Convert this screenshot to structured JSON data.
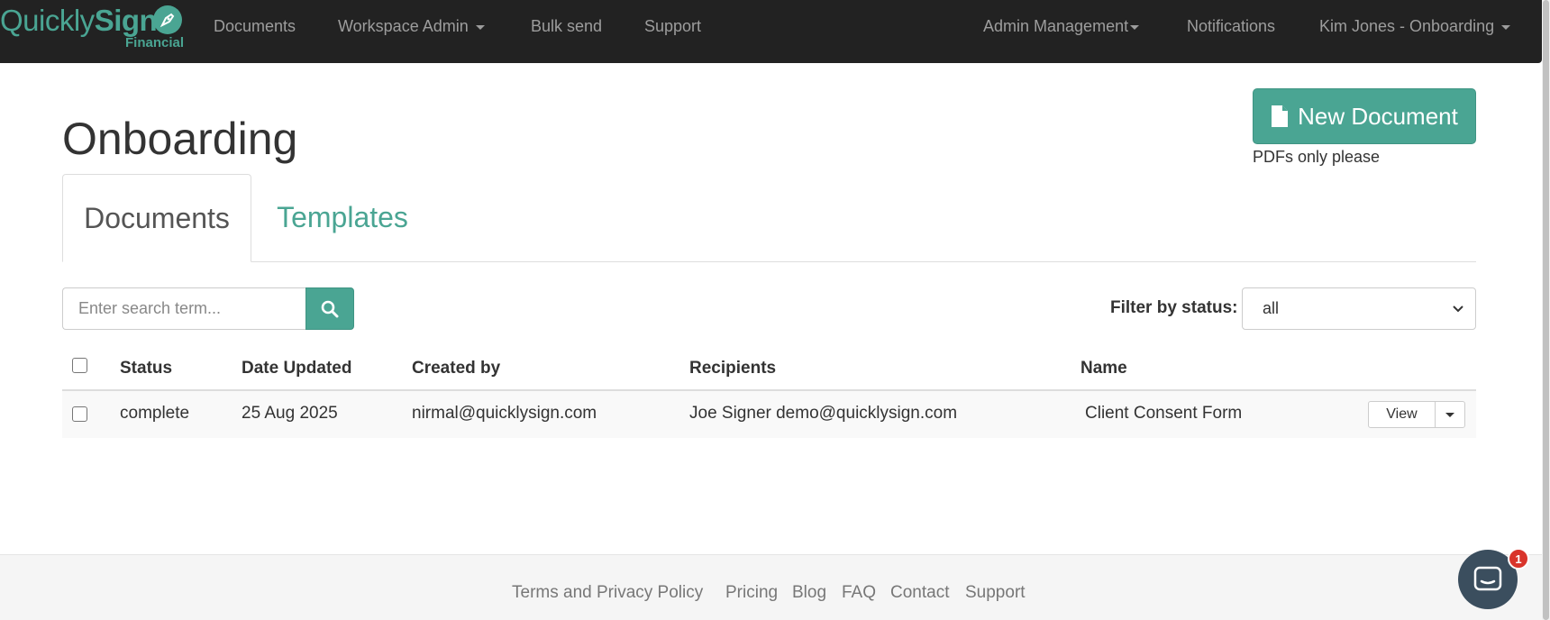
{
  "brand": {
    "name_light": "Quickly",
    "name_bold": "Sign",
    "subtitle": "Financial",
    "accent_color": "#4aa593",
    "icon": "pen-nib-icon"
  },
  "nav": {
    "documents": "Documents",
    "workspace_admin": "Workspace Admin",
    "bulk_send": "Bulk send",
    "support": "Support",
    "admin_management": "Admin Management",
    "notifications": "Notifications",
    "user": "Kim Jones - Onboarding"
  },
  "page": {
    "title": "Onboarding",
    "new_document_label": "New Document",
    "new_document_icon": "file-icon",
    "pdf_note": "PDFs only please"
  },
  "tabs": {
    "documents": "Documents",
    "templates": "Templates",
    "active": "Documents"
  },
  "search": {
    "placeholder": "Enter search term...",
    "value": "",
    "icon": "search-icon"
  },
  "filter": {
    "label": "Filter by status:",
    "selected": "all"
  },
  "table": {
    "headers": {
      "status": "Status",
      "date_updated": "Date Updated",
      "created_by": "Created by",
      "recipients": "Recipients",
      "name": "Name"
    },
    "rows": [
      {
        "status": "complete",
        "date_updated": "25 Aug 2025",
        "created_by": "nirmal@quicklysign.com",
        "recipients": "Joe Signer demo@quicklysign.com",
        "name": "Client Consent Form",
        "action": "View"
      }
    ]
  },
  "footer": {
    "terms": "Terms and Privacy Policy",
    "pricing": "Pricing",
    "blog": "Blog",
    "faq": "FAQ",
    "contact": "Contact",
    "support": "Support"
  },
  "chat": {
    "badge_count": "1",
    "icon": "chat-icon"
  }
}
